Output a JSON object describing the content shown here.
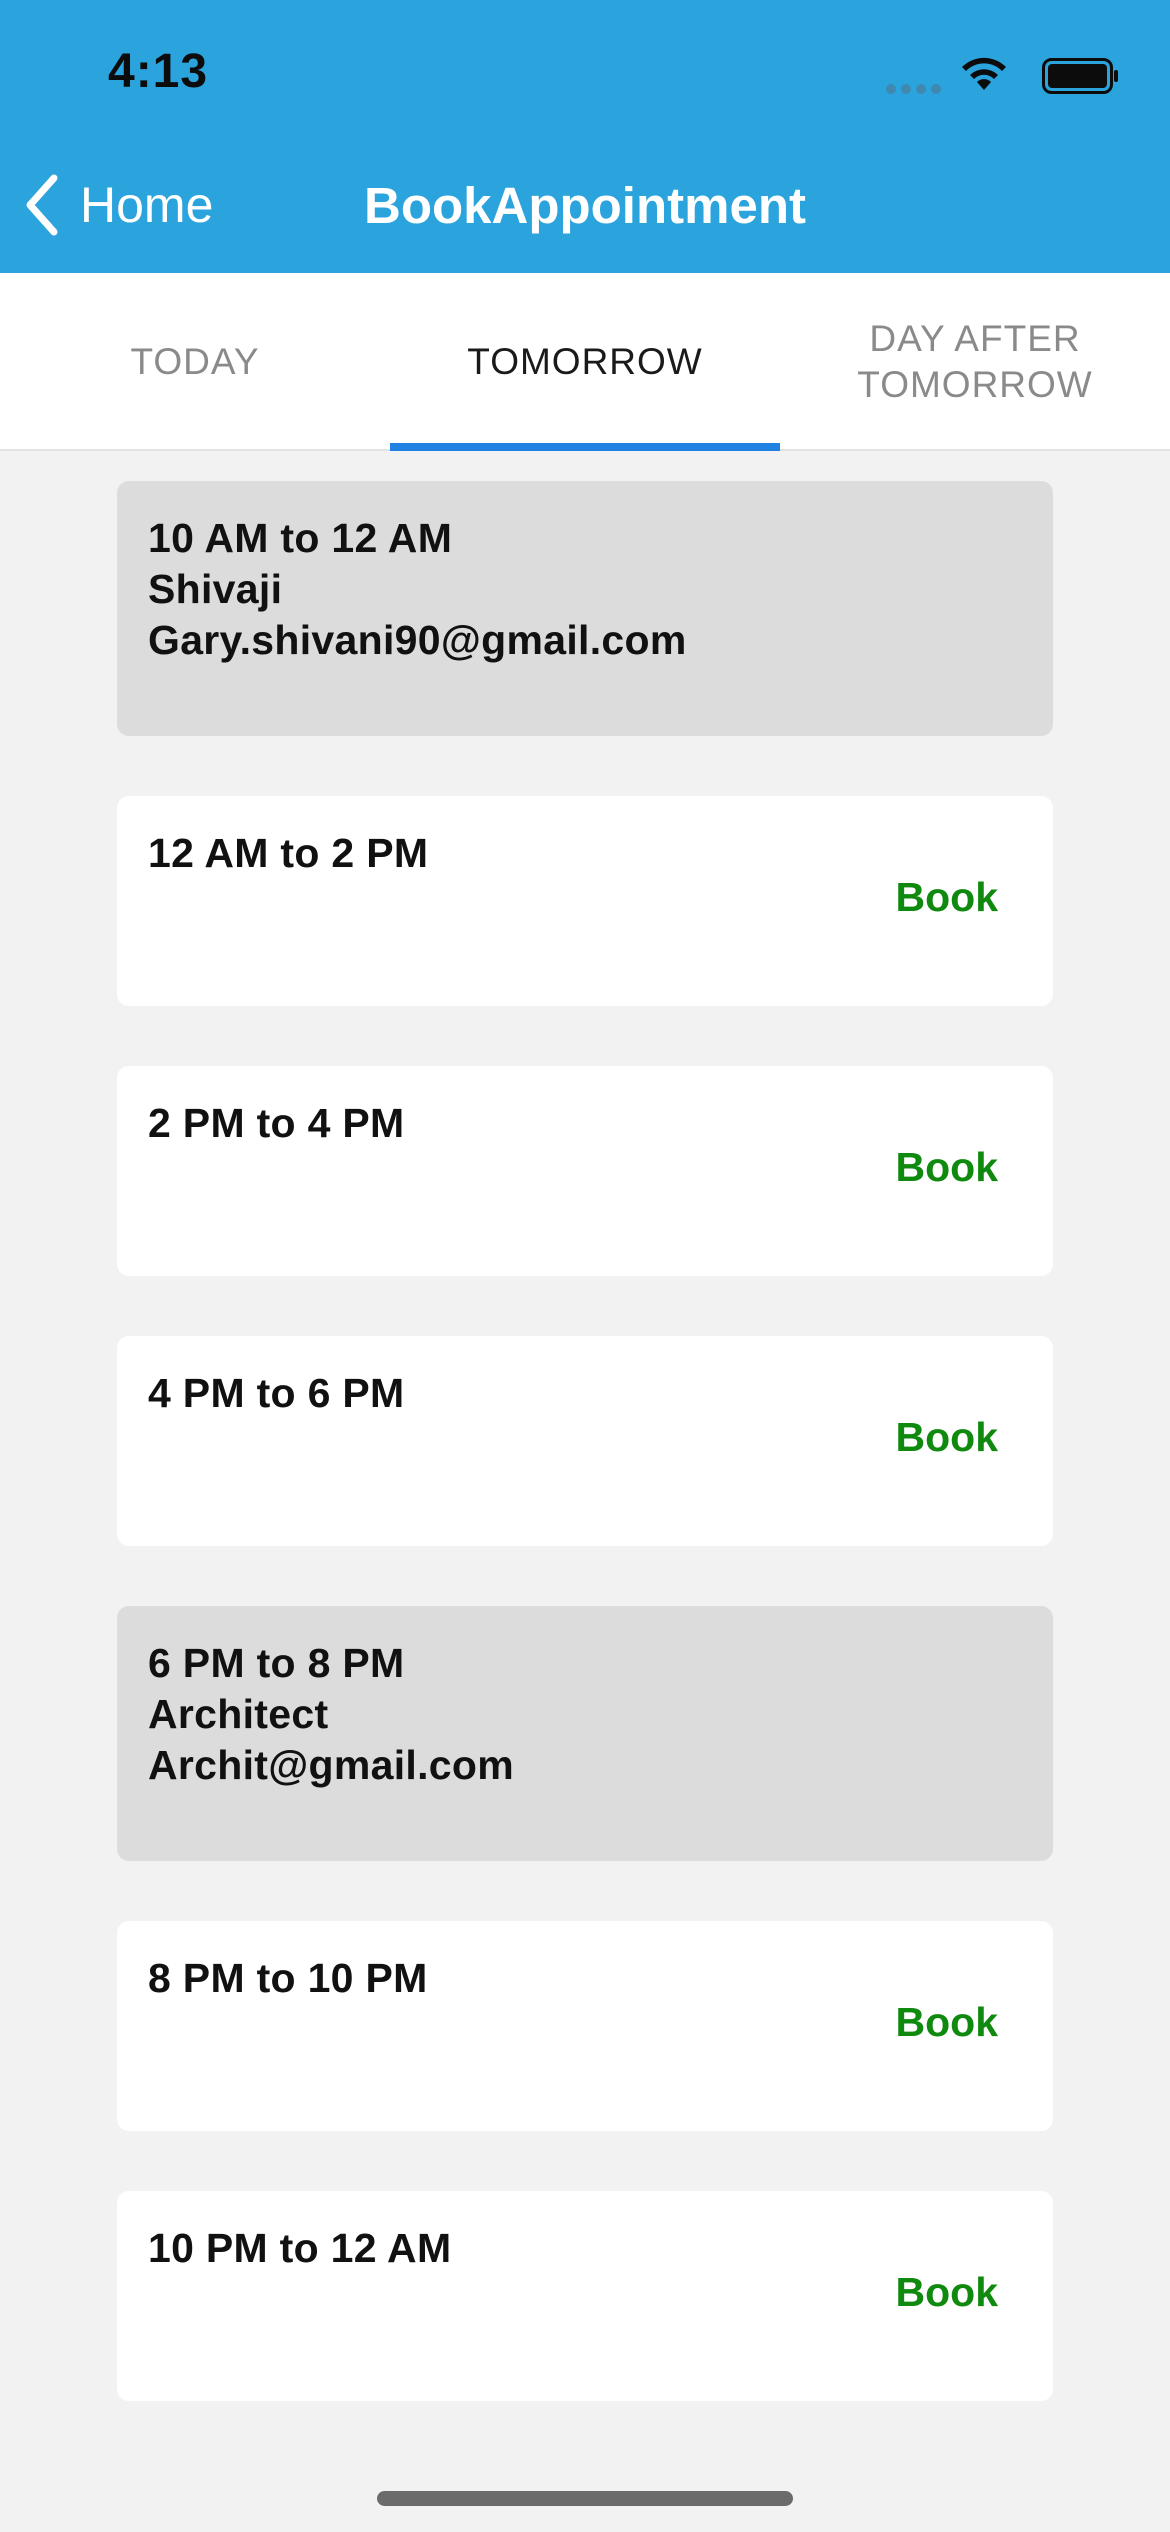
{
  "status_bar": {
    "time": "4:13",
    "icons": [
      "cellular-signal-icon",
      "wifi-icon",
      "battery-icon"
    ]
  },
  "nav": {
    "back_label": "Home",
    "title": "BookAppointment",
    "back_icon": "chevron-left-icon"
  },
  "tabs": [
    {
      "label": "TODAY",
      "active": false
    },
    {
      "label": "TOMORROW",
      "active": true
    },
    {
      "label": "DAY AFTER TOMORROW",
      "line1": "DAY AFTER",
      "line2": "TOMORROW",
      "active": false
    }
  ],
  "slots": [
    {
      "time": "10 AM to 12 AM",
      "booked": true,
      "name": "Shivaji",
      "email": "Gary.shivani90@gmail.com"
    },
    {
      "time": "12 AM to 2 PM",
      "booked": false,
      "action": "Book"
    },
    {
      "time": "2 PM to 4 PM",
      "booked": false,
      "action": "Book"
    },
    {
      "time": "4 PM to 6 PM",
      "booked": false,
      "action": "Book"
    },
    {
      "time": "6 PM to 8 PM",
      "booked": true,
      "name": "Architect",
      "email": "Archit@gmail.com"
    },
    {
      "time": "8 PM to 10 PM",
      "booked": false,
      "action": "Book"
    },
    {
      "time": "10 PM to 12 AM",
      "booked": false,
      "action": "Book"
    }
  ],
  "colors": {
    "header": "#2ba3dc",
    "tab_indicator": "#1f82e3",
    "book_action": "#0f8a0f",
    "booked_slot": "#dcdcdc"
  }
}
